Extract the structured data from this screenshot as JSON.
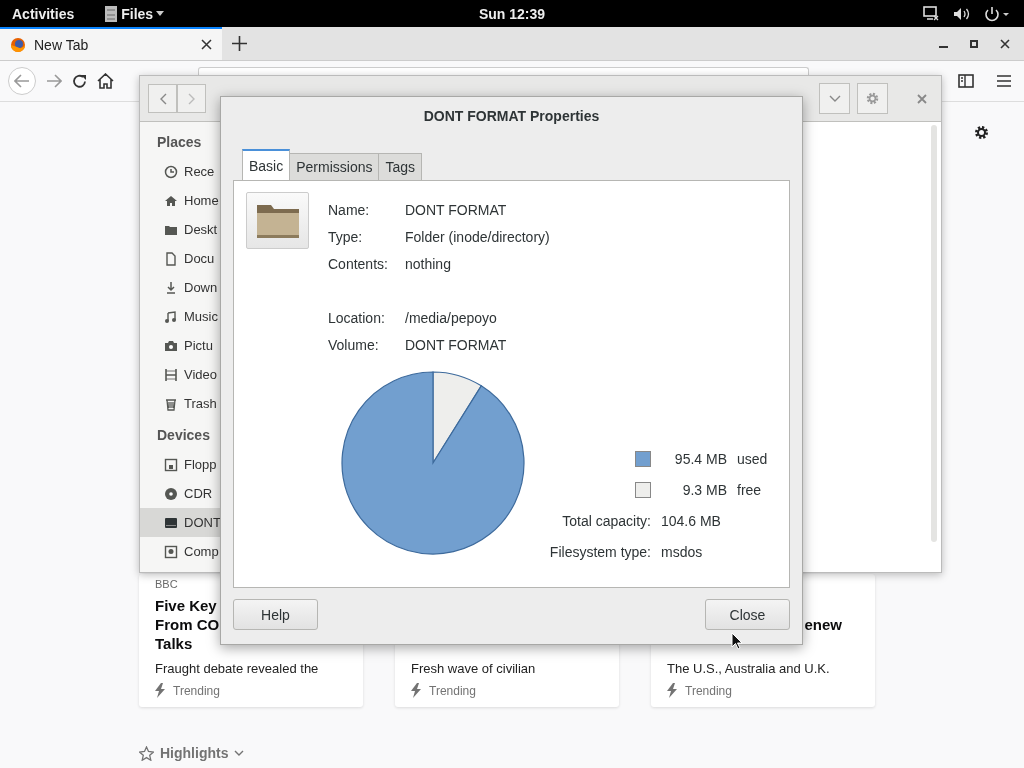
{
  "top_bar": {
    "activities": "Activities",
    "app_menu": "Files",
    "clock": "Sun 12:39"
  },
  "browser": {
    "tabs": [
      {
        "title": "New Tab",
        "selected": true
      }
    ],
    "cards": [
      {
        "kind": "full",
        "source": "BBC",
        "title_lines": [
          "Five Key",
          "From CO",
          "Talks"
        ],
        "description": "Fraught debate revealed the",
        "badge": "Trending"
      },
      {
        "description": "Fresh wave of civilian",
        "badge": "Trending"
      },
      {
        "kind": "clipped",
        "title_lines": [
          "enew"
        ],
        "description": "The U.S., Australia and U.K.",
        "badge": "Trending"
      }
    ],
    "highlights": "Highlights"
  },
  "files_window": {
    "sidebar": [
      {
        "heading": "Places",
        "items": [
          {
            "label": "Rece",
            "selected": false
          },
          {
            "label": "Home",
            "selected": false
          },
          {
            "label": "Deskt",
            "selected": false
          },
          {
            "label": "Docu",
            "selected": false
          },
          {
            "label": "Down",
            "selected": false
          },
          {
            "label": "Music",
            "selected": false
          },
          {
            "label": "Pictu",
            "selected": false
          },
          {
            "label": "Video",
            "selected": false
          },
          {
            "label": "Trash",
            "selected": false
          }
        ]
      },
      {
        "heading": "Devices",
        "items": [
          {
            "label": "Flopp",
            "selected": false
          },
          {
            "label": "CDR",
            "selected": false
          },
          {
            "label": "DONT",
            "selected": true
          },
          {
            "label": "Comp",
            "selected": false
          }
        ]
      }
    ]
  },
  "dialog": {
    "title": "DONT FORMAT Properties",
    "tabs": [
      {
        "label": "Basic",
        "selected": true
      },
      {
        "label": "Permissions",
        "selected": false
      },
      {
        "label": "Tags",
        "selected": false
      }
    ],
    "field_groups": [
      [
        {
          "label": "Name:",
          "value": "DONT FORMAT"
        },
        {
          "label": "Type:",
          "value": "Folder (inode/directory)"
        },
        {
          "label": "Contents:",
          "value": "nothing"
        }
      ],
      [
        {
          "label": "Location:",
          "value": "/media/pepoyo"
        },
        {
          "label": "Volume:",
          "value": "DONT FORMAT"
        }
      ]
    ],
    "chart_data": {
      "type": "pie",
      "categories": [
        "used",
        "free"
      ],
      "values": [
        91.1,
        8.9
      ]
    },
    "legend": [
      {
        "value": "95.4 MB",
        "color": "#729fcf"
      },
      {
        "value": "9.3 MB",
        "color": "#eeeeec"
      }
    ],
    "info": [
      {
        "label": "Total capacity:",
        "value": "104.6 MB"
      },
      {
        "label": "Filesystem type:",
        "value": "msdos"
      }
    ],
    "buttons": [
      {
        "label": "Help"
      },
      {
        "label": "Close"
      }
    ]
  }
}
